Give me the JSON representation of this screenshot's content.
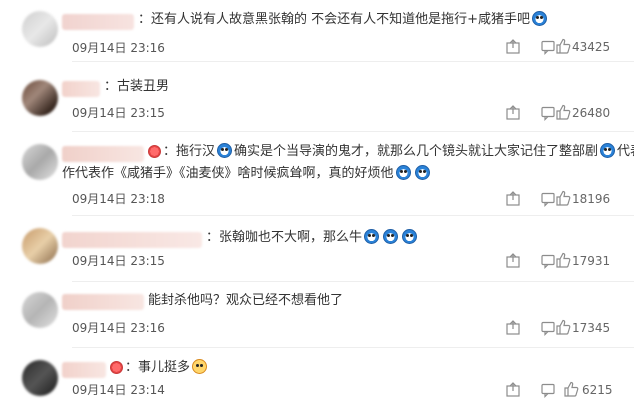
{
  "comments": [
    {
      "text": "：还有人说有人故意黑张翰的 不会还有人不知道他是拖行+咸猪手吧",
      "time": "09月14日 23:16",
      "likes": "43425",
      "emojis": [
        "doraemon-emoji"
      ]
    },
    {
      "text": "：古装丑男",
      "time": "09月14日 23:15",
      "likes": "26480",
      "emojis": []
    },
    {
      "text_part1": "拖行汉",
      "text_part2": "确实是个当导演的鬼才，就那么几个镜头就让大家记住了整部剧",
      "text_part3": "代表作《咸猪手》《油麦侠》啥时候疯耸啊，真的好烦他",
      "time": "09月14日 23:18",
      "likes": "18196",
      "emojis": [
        "heart-emoji",
        "doraemon-emoji",
        "doraemon-emoji",
        "doraemon-emoji",
        "doraemon-emoji"
      ]
    },
    {
      "text": "：张翰咖也不大啊，那么牛",
      "time": "09月14日 23:15",
      "likes": "17931",
      "emojis": [
        "doraemon-emoji",
        "doraemon-emoji",
        "doraemon-emoji"
      ]
    },
    {
      "text": "能封杀他吗？观众已经不想看他了",
      "time": "09月14日 23:16",
      "likes": "17345",
      "emojis": []
    },
    {
      "text": "：事儿挺多",
      "time": "09月14日 23:14",
      "likes": "6215",
      "emojis": [
        "heart-emoji",
        "smile-emoji"
      ]
    }
  ],
  "icons": {
    "share": "share-icon",
    "comment": "comment-icon",
    "like": "thumbs-up-icon"
  },
  "colors": {
    "text": "#333333",
    "meta": "#555555",
    "icon": "#8c8c8c"
  }
}
